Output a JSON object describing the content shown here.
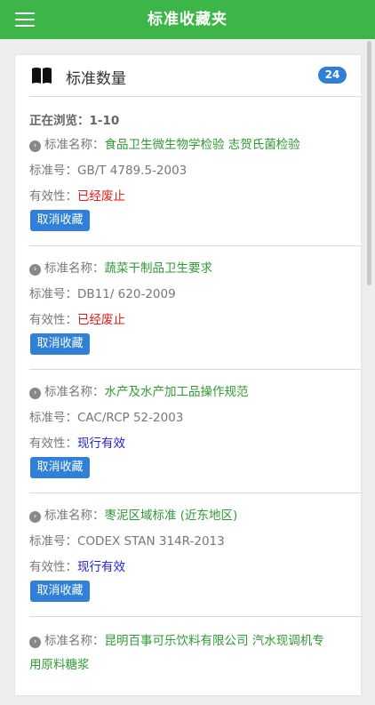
{
  "header": {
    "title": "标准收藏夹"
  },
  "card": {
    "title": "标准数量",
    "count": "24",
    "browsing": "正在浏览：1-10"
  },
  "labels": {
    "name": "标准名称：",
    "id": "标准号：",
    "validity": "有效性：",
    "cancel": "取消收藏"
  },
  "items": [
    {
      "name": "食品卫生微生物学检验 志贺氏菌检验",
      "id": "GB/T 4789.5-2003",
      "validity": "已经废止",
      "validity_color": "#e31b1b"
    },
    {
      "name": "蔬菜干制品卫生要求",
      "id": "DB11/ 620-2009",
      "validity": "已经废止",
      "validity_color": "#e31b1b"
    },
    {
      "name": "水产及水产加工品操作规范",
      "id": "CAC/RCP 52-2003",
      "validity": "现行有效",
      "validity_color": "#2222dd"
    },
    {
      "name": "枣泥区域标准 (近东地区)",
      "id": "CODEX STAN 314R-2013",
      "validity": "现行有效",
      "validity_color": "#2222dd"
    },
    {
      "name": "昆明百事可乐饮料有限公司 汽水现调机专",
      "name_cont": "用原料糖浆"
    }
  ],
  "icons": {
    "menu": "menu-icon",
    "book": "book-icon",
    "arrow": "chevron-right-icon"
  }
}
